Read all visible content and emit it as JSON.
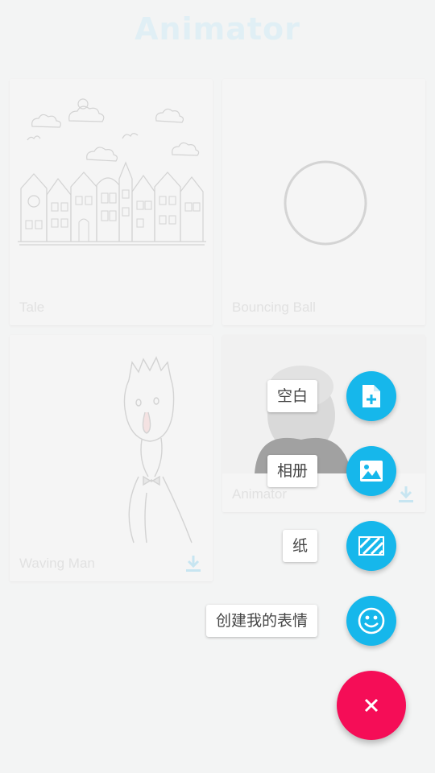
{
  "app": {
    "title": "Animator"
  },
  "cards": [
    {
      "label": "Tale"
    },
    {
      "label": "Bouncing Ball"
    },
    {
      "label": "Waving Man"
    },
    {
      "label": "Animator"
    }
  ],
  "speed_dial": {
    "items": [
      {
        "label": "空白",
        "icon": "new-file-icon"
      },
      {
        "label": "相册",
        "icon": "image-icon"
      },
      {
        "label": "纸",
        "icon": "paper-texture-icon"
      },
      {
        "label": "创建我的表情",
        "icon": "smiley-icon"
      }
    ],
    "close_icon": "close-icon"
  },
  "colors": {
    "accent": "#16b7eb",
    "fab": "#f50d57",
    "title": "#c6e6f3"
  }
}
